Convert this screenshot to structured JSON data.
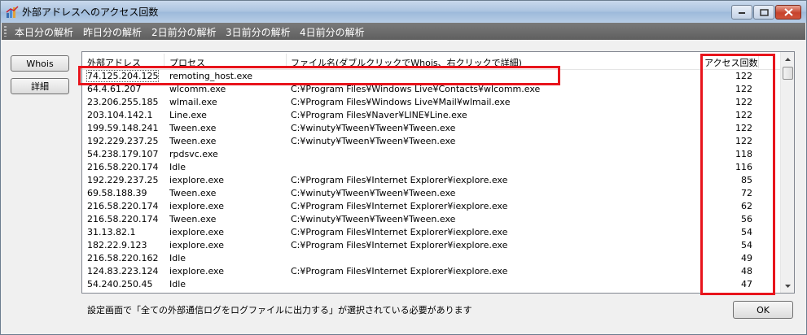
{
  "window": {
    "title": "外部アドレスへのアクセス回数"
  },
  "menu": {
    "items": [
      "本日分の解析",
      "昨日分の解析",
      "2日前分の解析",
      "3日前分の解析",
      "4日前分の解析"
    ]
  },
  "side_buttons": {
    "whois": "Whois",
    "detail": "詳細"
  },
  "list": {
    "columns": {
      "ip": "外部アドレス",
      "process": "プロセス",
      "file": "ファイル名(ダブルクリックでWhois、右クリックで詳細)",
      "count": "アクセス回数"
    },
    "rows": [
      {
        "ip": "74.125.204.125",
        "process": "remoting_host.exe",
        "file": "",
        "count": "122"
      },
      {
        "ip": "64.4.61.207",
        "process": "wlcomm.exe",
        "file": "C:¥Program Files¥Windows Live¥Contacts¥wlcomm.exe",
        "count": "122"
      },
      {
        "ip": "23.206.255.185",
        "process": "wlmail.exe",
        "file": "C:¥Program Files¥Windows Live¥Mail¥wlmail.exe",
        "count": "122"
      },
      {
        "ip": "203.104.142.1",
        "process": "Line.exe",
        "file": "C:¥Program Files¥Naver¥LINE¥Line.exe",
        "count": "122"
      },
      {
        "ip": "199.59.148.241",
        "process": "Tween.exe",
        "file": "C:¥winuty¥Tween¥Tween¥Tween.exe",
        "count": "122"
      },
      {
        "ip": "192.229.237.25",
        "process": "Tween.exe",
        "file": "C:¥winuty¥Tween¥Tween¥Tween.exe",
        "count": "122"
      },
      {
        "ip": "54.238.179.107",
        "process": "rpdsvc.exe",
        "file": "",
        "count": "118"
      },
      {
        "ip": "216.58.220.174",
        "process": "Idle",
        "file": "",
        "count": "116"
      },
      {
        "ip": "192.229.237.25",
        "process": "iexplore.exe",
        "file": "C:¥Program Files¥Internet Explorer¥iexplore.exe",
        "count": "85"
      },
      {
        "ip": "69.58.188.39",
        "process": "Tween.exe",
        "file": "C:¥winuty¥Tween¥Tween¥Tween.exe",
        "count": "72"
      },
      {
        "ip": "216.58.220.174",
        "process": "iexplore.exe",
        "file": "C:¥Program Files¥Internet Explorer¥iexplore.exe",
        "count": "62"
      },
      {
        "ip": "216.58.220.174",
        "process": "Tween.exe",
        "file": "C:¥winuty¥Tween¥Tween¥Tween.exe",
        "count": "56"
      },
      {
        "ip": "31.13.82.1",
        "process": "iexplore.exe",
        "file": "C:¥Program Files¥Internet Explorer¥iexplore.exe",
        "count": "54"
      },
      {
        "ip": "182.22.9.123",
        "process": "iexplore.exe",
        "file": "C:¥Program Files¥Internet Explorer¥iexplore.exe",
        "count": "54"
      },
      {
        "ip": "216.58.220.162",
        "process": "Idle",
        "file": "",
        "count": "49"
      },
      {
        "ip": "124.83.223.124",
        "process": "iexplore.exe",
        "file": "C:¥Program Files¥Internet Explorer¥iexplore.exe",
        "count": "48"
      },
      {
        "ip": "54.240.250.45",
        "process": "Idle",
        "file": "",
        "count": "47"
      }
    ]
  },
  "footer": {
    "note": "設定画面で「全ての外部通信ログをログファイルに出力する」が選択されている必要があります",
    "ok": "OK"
  },
  "colors": {
    "highlight": "#e8141c",
    "menubar": "#6a6a6a"
  },
  "icons": {
    "app": "chart-app-icon",
    "minimize": "minimize-icon",
    "maximize": "maximize-icon",
    "close": "close-icon",
    "scroll_up": "scroll-up-icon",
    "scroll_down": "scroll-down-icon"
  }
}
